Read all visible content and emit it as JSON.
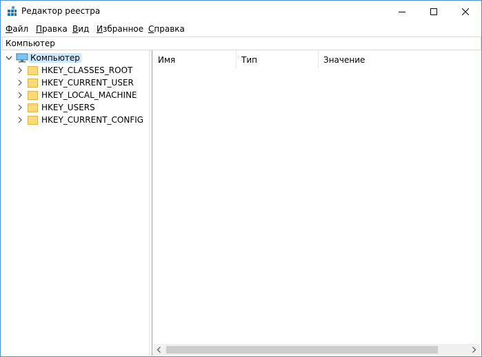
{
  "window": {
    "title": "Редактор реестра",
    "accent_color": "#4a90d9"
  },
  "menu": {
    "items": [
      "Файл",
      "Правка",
      "Вид",
      "Избранное",
      "Справка"
    ]
  },
  "address": {
    "path": "Компьютер"
  },
  "tree": {
    "root": {
      "label": "Компьютер",
      "icon": "computer-icon",
      "expanded": true,
      "selected": true
    },
    "children": [
      {
        "label": "HKEY_CLASSES_ROOT",
        "icon": "folder-icon"
      },
      {
        "label": "HKEY_CURRENT_USER",
        "icon": "folder-icon"
      },
      {
        "label": "HKEY_LOCAL_MACHINE",
        "icon": "folder-icon"
      },
      {
        "label": "HKEY_USERS",
        "icon": "folder-icon"
      },
      {
        "label": "HKEY_CURRENT_CONFIG",
        "icon": "folder-icon"
      }
    ]
  },
  "list": {
    "columns": [
      "Имя",
      "Тип",
      "Значение"
    ]
  }
}
